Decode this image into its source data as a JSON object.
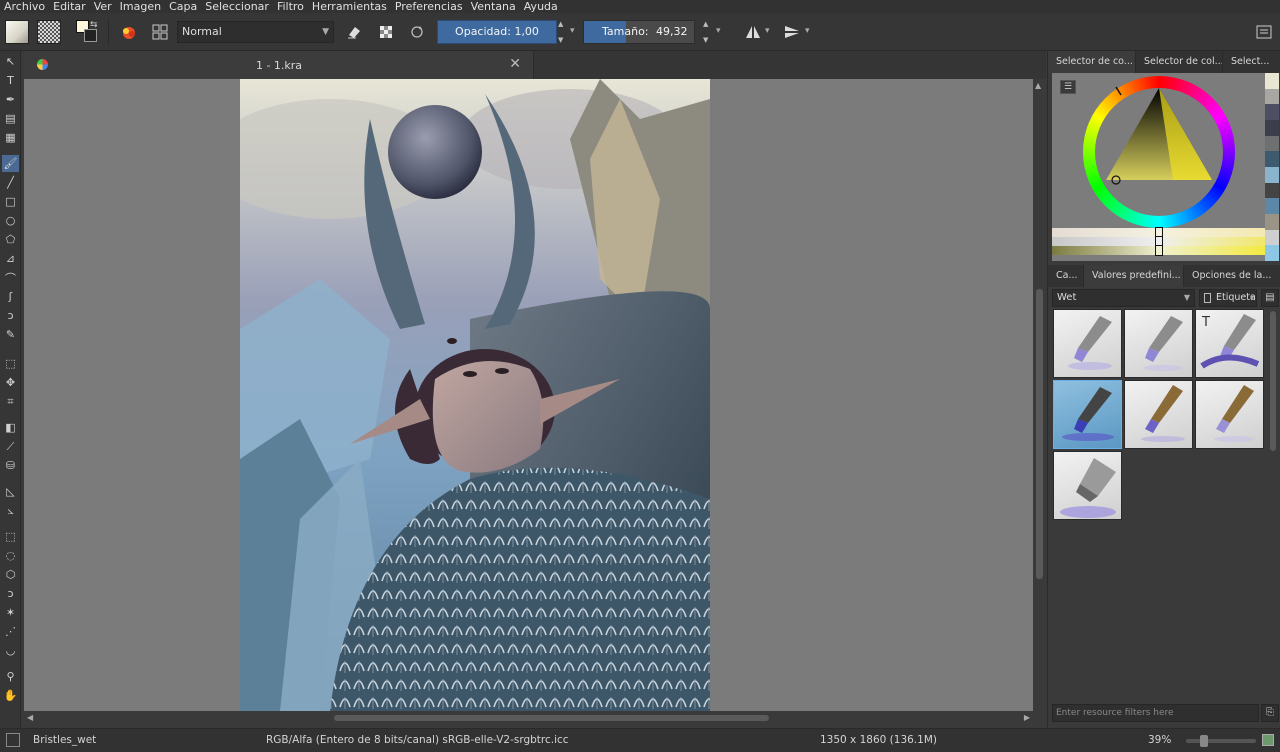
{
  "menubar": {
    "items": [
      "Archivo",
      "Editar",
      "Ver",
      "Imagen",
      "Capa",
      "Seleccionar",
      "Filtro",
      "Herramientas",
      "Preferencias",
      "Ventana",
      "Ayuda"
    ]
  },
  "toolbar": {
    "blend_mode": "Normal",
    "opacity": "Opacidad:  1,00",
    "size_label": "Tamaño:",
    "size_value": "49,32 px"
  },
  "document": {
    "tab_title": "1 - 1.kra"
  },
  "docker": {
    "color_tabs": [
      "Selector de co...",
      "Selector de col...",
      "Select..."
    ],
    "preset_tabs": [
      "Ca...",
      "Valores predefini...",
      "Opciones de la..."
    ],
    "preset_filter": "Wet",
    "tag_label": "Etiqueta",
    "filter_placeholder": "Enter resource filters here",
    "selected_preset_index": 3,
    "swatches": [
      "#e9e6d4",
      "#a8a7a1",
      "#4e4f63",
      "#3c3e4c",
      "#6e7072",
      "#3e5a6e",
      "#8ab3cc",
      "#444444",
      "#5c87a6",
      "#9a9486",
      "#cfcfcf",
      "#8cc8e6"
    ]
  },
  "statusbar": {
    "preset_name": "Bristles_wet",
    "color_space": "RGB/Alfa (Entero de 8 bits/canal)  sRGB-elle-V2-srgbtrc.icc",
    "dimensions": "1350 x 1860 (136.1M)",
    "zoom": "39%"
  }
}
